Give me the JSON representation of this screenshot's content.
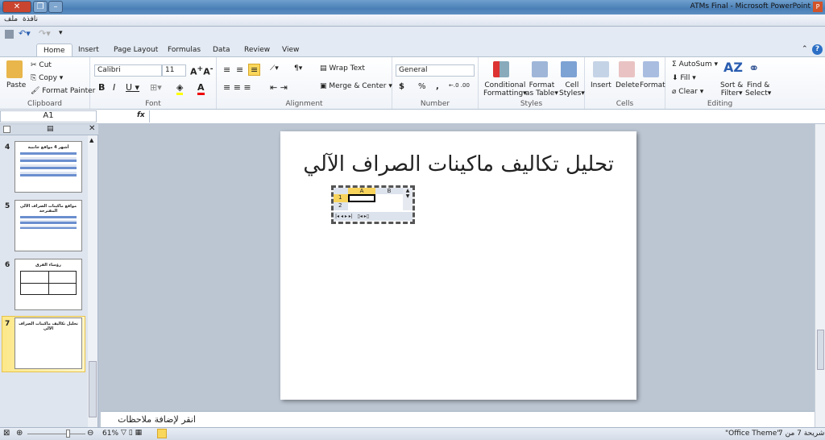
{
  "window": {
    "title": "ATMs Final - Microsoft PowerPoint",
    "app_icon": "P"
  },
  "menu": {
    "items": [
      "ملف",
      "نافذة"
    ]
  },
  "tabs": [
    "Home",
    "Insert",
    "Page Layout",
    "Formulas",
    "Data",
    "Review",
    "View"
  ],
  "ribbon": {
    "clipboard": {
      "label": "Clipboard",
      "paste": "Paste",
      "cut": "Cut",
      "copy": "Copy",
      "format_painter": "Format Painter"
    },
    "font": {
      "label": "Font",
      "name": "Calibri",
      "size": "11"
    },
    "alignment": {
      "label": "Alignment",
      "wrap": "Wrap Text",
      "merge": "Merge & Center"
    },
    "number": {
      "label": "Number",
      "format": "General",
      "currency": "$",
      "percent": "%",
      "comma": ","
    },
    "styles": {
      "label": "Styles",
      "conditional": [
        "Conditional",
        "Formatting"
      ],
      "format_table": [
        "Format",
        "as Table"
      ],
      "cell_styles": [
        "Cell",
        "Styles"
      ]
    },
    "cells": {
      "label": "Cells",
      "insert": "Insert",
      "delete": "Delete",
      "format": "Format"
    },
    "editing": {
      "label": "Editing",
      "autosum": "AutoSum",
      "fill": "Fill",
      "clear": "Clear",
      "sort": [
        "Sort &",
        "Filter"
      ],
      "find": [
        "Find &",
        "Select"
      ]
    }
  },
  "formula_bar": {
    "name_box": "A1",
    "fx": "fx",
    "value": ""
  },
  "slides": [
    {
      "num": "4",
      "title": "أشهر 4 مواقع جانبية"
    },
    {
      "num": "5",
      "title": "مواقع ماكينات الصراف الآلي المقترحة"
    },
    {
      "num": "6",
      "title": "رؤساء الفرق"
    },
    {
      "num": "7",
      "title": "تحليل تكاليف ماكينات الصراف الآلي"
    }
  ],
  "slide": {
    "title": "تحليل تكاليف ماكينات الصراف الآلي",
    "sheet": {
      "columns": [
        "A",
        "B"
      ],
      "rows": [
        "1",
        "2"
      ]
    }
  },
  "notes": {
    "placeholder": "انقر لإضافة ملاحظات"
  },
  "status": {
    "zoom": "61%",
    "theme": "\"Office Theme\"",
    "slide_of": "شريحة 7 من 7"
  }
}
